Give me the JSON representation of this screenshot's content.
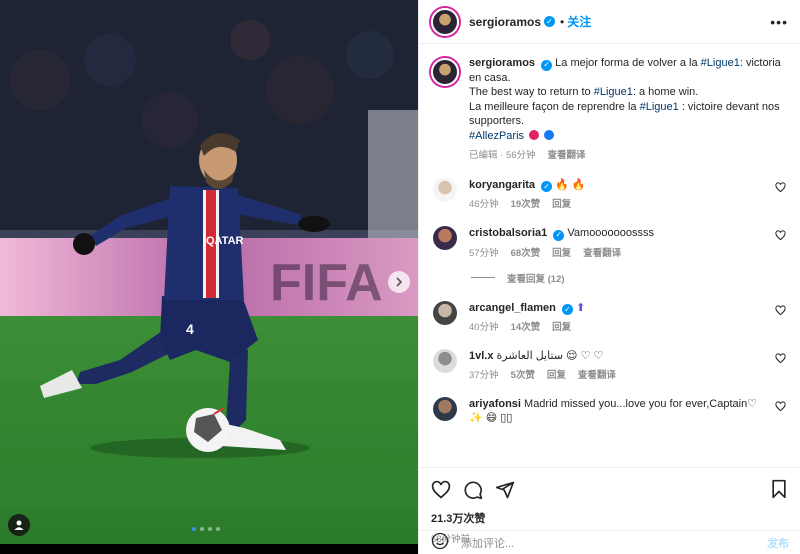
{
  "header": {
    "username": "sergioramos",
    "separator": "•",
    "follow_label": "关注",
    "more_label": "•••"
  },
  "caption": {
    "username": "sergioramos",
    "line1": "La mejor forma de volver a la ",
    "line1_hashtag": "#Ligue1",
    "line1_end": ": victoria en casa.",
    "line2": "The best way to return to ",
    "line2_hashtag": "#Ligue1",
    "line2_end": ": a home win.",
    "line3": "La meilleure façon de reprendre la ",
    "line3_hashtag": "#Ligue1",
    "line3_end": " : victoire devant nos supporters.",
    "line4_hashtag": "#AllezParis",
    "edited": "已编辑 · 56分钟",
    "see_translation": "查看翻译"
  },
  "comments": [
    {
      "username": "koryangarita",
      "verified": true,
      "text": "",
      "emoji": "🔥 🔥",
      "time": "46分钟",
      "likes": "19次赞",
      "reply": "回复",
      "translate": ""
    },
    {
      "username": "cristobalsoria1",
      "verified": true,
      "text": "Vamooooooossss",
      "emoji": "",
      "time": "57分钟",
      "likes": "68次赞",
      "reply": "回复",
      "translate": "查看翻译"
    },
    {
      "username": "arcangel_flamen",
      "verified": true,
      "text": "",
      "emoji": "⬆",
      "time": "40分钟",
      "likes": "14次赞",
      "reply": "回复",
      "translate": ""
    },
    {
      "username": "1vl.x",
      "verified": false,
      "text": "ستايل العاشرة 😌 ♡ ♡",
      "emoji": "",
      "time": "37分钟",
      "likes": "5次赞",
      "reply": "回复",
      "translate": "查看翻译"
    },
    {
      "username": "ariyafonsi",
      "verified": false,
      "text": "Madrid missed you...love you for ever,Captain♡ ✨ 😄 ▯▯",
      "emoji": "",
      "time": "",
      "likes": "",
      "reply": "",
      "translate": ""
    }
  ],
  "view_replies": "查看回复 (12)",
  "actions": {
    "likes": "21.3万次赞",
    "time": "58分钟前"
  },
  "add_comment": {
    "placeholder": "添加评论...",
    "post_label": "发布"
  },
  "colors": {
    "accent": "#0095f6",
    "hashtag": "#00376b",
    "muted": "#8e8e8e",
    "story_ring": "#d6249f"
  },
  "carousel": {
    "count": 4,
    "active": 1
  }
}
